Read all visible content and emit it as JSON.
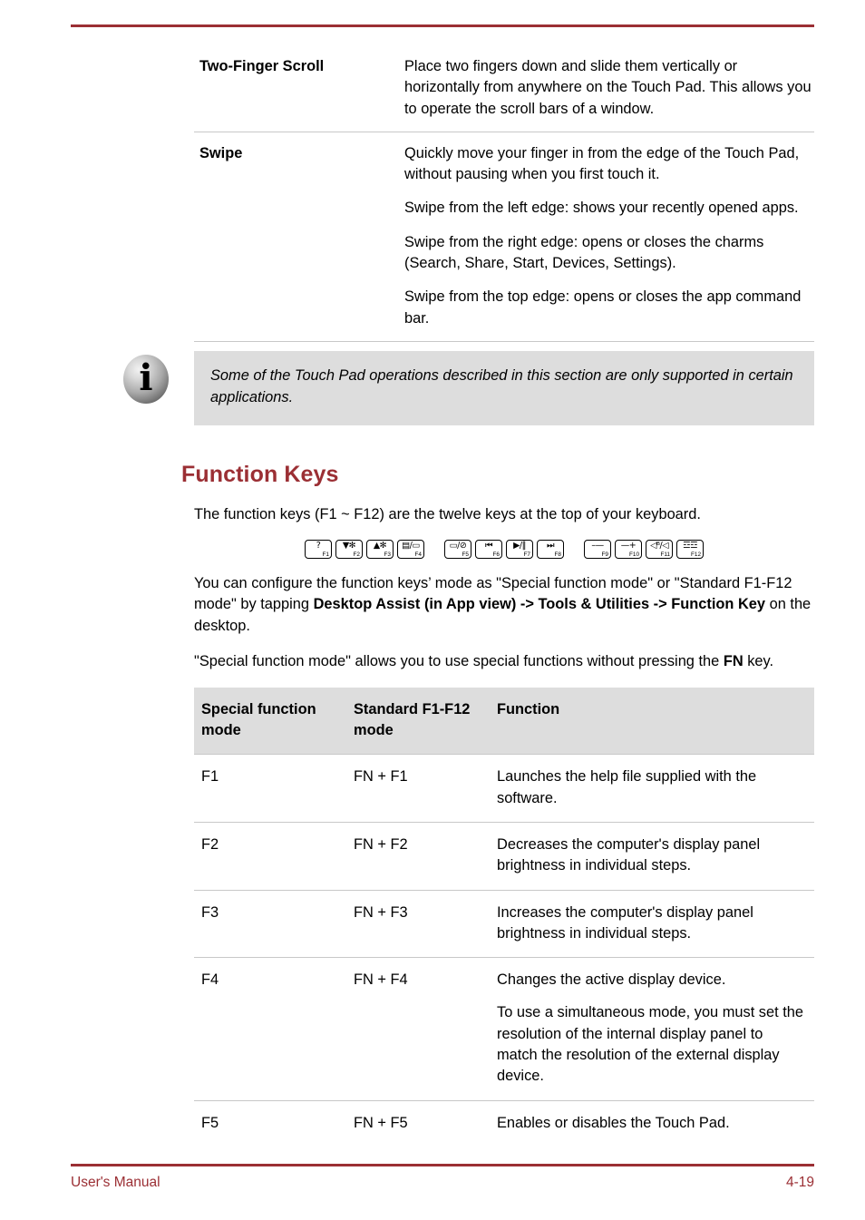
{
  "document": {
    "footer_left": "User's Manual",
    "footer_page": "4-19",
    "accent_color": "#9b2f34"
  },
  "gestures_table": {
    "rows": [
      {
        "term": "Two-Finger Scroll",
        "paragraphs": [
          "Place two fingers down and slide them vertically or horizontally from anywhere on the Touch Pad. This allows you to operate the scroll bars of a window."
        ]
      },
      {
        "term": "Swipe",
        "paragraphs": [
          "Quickly move your finger in from the edge of the Touch Pad, without pausing when you first touch it.",
          "Swipe from the left edge: shows your recently opened apps.",
          "Swipe from the right edge: opens or closes the charms (Search, Share, Start, Devices, Settings).",
          "Swipe from the top edge: opens or closes the app command bar."
        ]
      }
    ]
  },
  "note": {
    "icon": "info-icon",
    "glyph": "i",
    "text": "Some of the Touch Pad operations described in this section are only supported in certain applications."
  },
  "section": {
    "heading": "Function Keys",
    "intro": "The function keys (F1 ~ F12) are the twelve keys at the top of your keyboard.",
    "configure_text_1": "You can configure the function keys’ mode as \"Special function mode\" or \"Standard F1-F12 mode\" by tapping ",
    "configure_bold": "Desktop Assist (in App view) -> Tools & Utilities -> Function Key",
    "configure_text_2": " on the desktop.",
    "special_text_1": "\"Special function mode\" allows you to use special functions without pressing the ",
    "special_bold": "FN",
    "special_text_2": " key."
  },
  "keystrip": {
    "groups": [
      {
        "keys": [
          {
            "glyph": "?",
            "label": "F1",
            "icon": "help-key-icon"
          },
          {
            "glyph": "▼✻",
            "label": "F2",
            "icon": "brightness-down-key-icon"
          },
          {
            "glyph": "▲✻",
            "label": "F3",
            "icon": "brightness-up-key-icon"
          },
          {
            "glyph": "▤/▭",
            "label": "F4",
            "icon": "display-switch-key-icon"
          }
        ]
      },
      {
        "keys": [
          {
            "glyph": "▭/⊘",
            "label": "F5",
            "icon": "touchpad-toggle-key-icon"
          },
          {
            "glyph": "⏮",
            "label": "F6",
            "icon": "previous-track-key-icon"
          },
          {
            "glyph": "▶/‖",
            "label": "F7",
            "icon": "play-pause-key-icon"
          },
          {
            "glyph": "⏭",
            "label": "F8",
            "icon": "next-track-key-icon"
          }
        ]
      },
      {
        "keys": [
          {
            "glyph": "–—",
            "label": "F9",
            "icon": "decrease-key-icon"
          },
          {
            "glyph": "—+",
            "label": "F10",
            "icon": "increase-key-icon"
          },
          {
            "glyph": "◁ᴮ/◁",
            "label": "F11",
            "icon": "mute-key-icon"
          },
          {
            "glyph": "☲☲",
            "label": "F12",
            "icon": "wireless-key-icon"
          }
        ]
      }
    ]
  },
  "fkeys_table": {
    "headers": [
      "Special function mode",
      "Standard F1-F12 mode",
      "Function"
    ],
    "rows": [
      {
        "special": "F1",
        "standard": "FN + F1",
        "function": [
          "Launches the help file supplied with the software."
        ]
      },
      {
        "special": "F2",
        "standard": "FN + F2",
        "function": [
          "Decreases the computer's display panel brightness in individual steps."
        ]
      },
      {
        "special": "F3",
        "standard": "FN + F3",
        "function": [
          "Increases the computer's display panel brightness in individual steps."
        ]
      },
      {
        "special": "F4",
        "standard": "FN + F4",
        "function": [
          "Changes the active display device.",
          "To use a simultaneous mode, you must set the resolution of the internal display panel to match the resolution of the external display device."
        ]
      },
      {
        "special": "F5",
        "standard": "FN + F5",
        "function": [
          "Enables or disables the Touch Pad."
        ]
      }
    ]
  }
}
